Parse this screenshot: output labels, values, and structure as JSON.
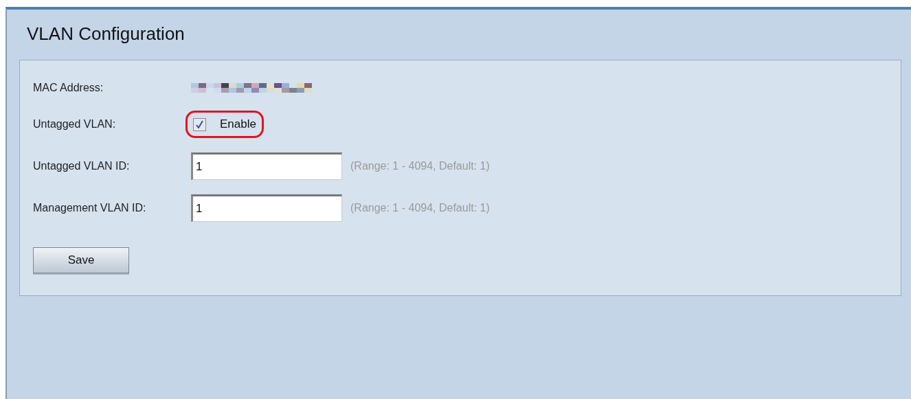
{
  "page_title": "VLAN Configuration",
  "mac_address": {
    "label": "MAC Address:"
  },
  "untagged_vlan": {
    "label": "Untagged VLAN:",
    "checkbox_label": "Enable",
    "checked": true,
    "highlighted": true
  },
  "fields": [
    {
      "label": "Untagged VLAN ID:",
      "value": "1",
      "hint": "(Range: 1 - 4094, Default: 1)"
    },
    {
      "label": "Management VLAN ID:",
      "value": "1",
      "hint": "(Range: 1 - 4094, Default: 1)"
    }
  ],
  "buttons": [
    "Save"
  ]
}
